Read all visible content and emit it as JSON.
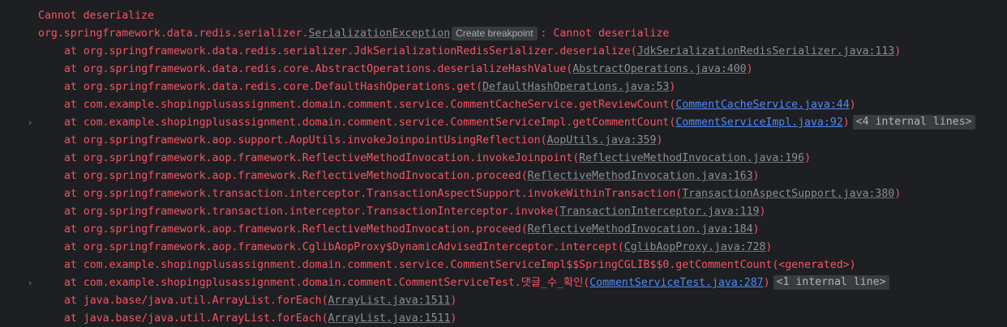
{
  "console": {
    "header": "Cannot deserialize",
    "exception": {
      "package": "org.springframework.data.redis.serializer.",
      "class": "SerializationException",
      "breakpoint_label": "Create breakpoint",
      "message": ": Cannot deserialize"
    },
    "frames": [
      {
        "prefix": "at org.springframework.data.redis.serializer.JdkSerializationRedisSerializer.deserialize(",
        "link": "JdkSerializationRedisSerializer.java:113",
        "suffix": ")"
      },
      {
        "prefix": "at org.springframework.data.redis.core.AbstractOperations.deserializeHashValue(",
        "link": "AbstractOperations.java:400",
        "suffix": ")"
      },
      {
        "prefix": "at org.springframework.data.redis.core.DefaultHashOperations.get(",
        "link": "DefaultHashOperations.java:53",
        "suffix": ")"
      },
      {
        "prefix": "at com.example.shopingplusassignment.domain.comment.service.CommentCacheService.getReviewCount(",
        "link": "CommentCacheService.java:44",
        "suffix": ")"
      },
      {
        "prefix": "at com.example.shopingplusassignment.domain.comment.service.CommentServiceImpl.getCommentCount(",
        "link": "CommentServiceImpl.java:92",
        "suffix": ")",
        "badge": "<4 internal lines>"
      },
      {
        "prefix": "at org.springframework.aop.support.AopUtils.invokeJoinpointUsingReflection(",
        "link": "AopUtils.java:359",
        "suffix": ")"
      },
      {
        "prefix": "at org.springframework.aop.framework.ReflectiveMethodInvocation.invokeJoinpoint(",
        "link": "ReflectiveMethodInvocation.java:196",
        "suffix": ")"
      },
      {
        "prefix": "at org.springframework.aop.framework.ReflectiveMethodInvocation.proceed(",
        "link": "ReflectiveMethodInvocation.java:163",
        "suffix": ")"
      },
      {
        "prefix": "at org.springframework.transaction.interceptor.TransactionAspectSupport.invokeWithinTransaction(",
        "link": "TransactionAspectSupport.java:380",
        "suffix": ")"
      },
      {
        "prefix": "at org.springframework.transaction.interceptor.TransactionInterceptor.invoke(",
        "link": "TransactionInterceptor.java:119",
        "suffix": ")"
      },
      {
        "prefix": "at org.springframework.aop.framework.ReflectiveMethodInvocation.proceed(",
        "link": "ReflectiveMethodInvocation.java:184",
        "suffix": ")"
      },
      {
        "prefix": "at org.springframework.aop.framework.CglibAopProxy$DynamicAdvisedInterceptor.intercept(",
        "link": "CglibAopProxy.java:728",
        "suffix": ")"
      },
      {
        "prefix": "at com.example.shopingplusassignment.domain.comment.service.CommentServiceImpl$$SpringCGLIB$$0.getCommentCount(<generated>)"
      },
      {
        "prefix": "at com.example.shopingplusassignment.domain.comment.CommentServiceTest.댓글_수_확인(",
        "link": "CommentServiceTest.java:287",
        "suffix": ")",
        "badge": "<1 internal line>"
      },
      {
        "prefix": "at java.base/java.util.ArrayList.forEach(",
        "link": "ArrayList.java:1511",
        "suffix": ")"
      },
      {
        "prefix": "at java.base/java.util.ArrayList.forEach(",
        "link": "ArrayList.java:1511",
        "suffix": ")"
      }
    ]
  }
}
